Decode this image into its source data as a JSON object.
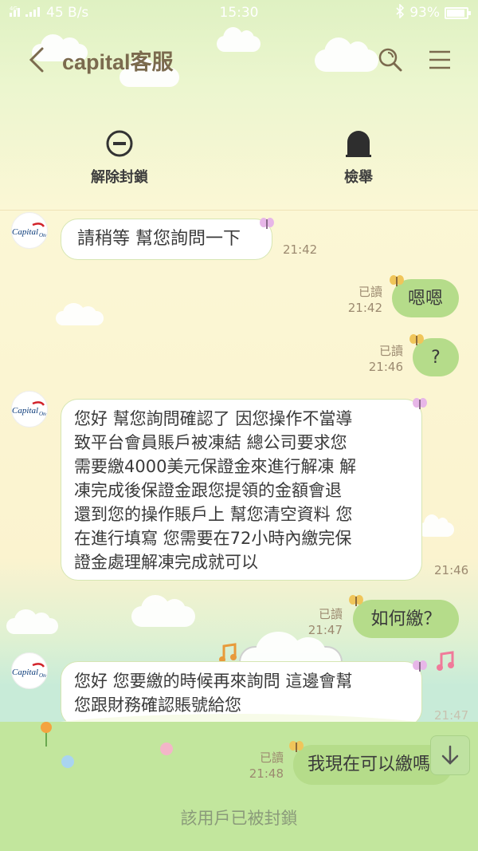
{
  "status_bar": {
    "network": "4G",
    "speed": "45 B/s",
    "time": "15:30",
    "battery": "93%",
    "battery_level": 0.93
  },
  "header": {
    "title": "capital客服",
    "back_icon": "chevron-left-icon",
    "search_icon": "search-icon",
    "menu_icon": "menu-icon"
  },
  "actions": {
    "unblock_label": "解除封鎖",
    "report_label": "檢舉"
  },
  "messages": [
    {
      "side": "in",
      "text": "請稍等 幫您詢問一下",
      "time": "21:42"
    },
    {
      "side": "out",
      "text": "嗯嗯",
      "read": "已讀",
      "time": "21:42"
    },
    {
      "side": "out",
      "text": "?",
      "read": "已讀",
      "time": "21:46"
    },
    {
      "side": "in",
      "lines": [
        "您好 幫您詢問確認了 因您操作不當導",
        "致平台會員賬戶被凍結 總公司要求您",
        "需要繳4000美元保證金來進行解凍 解",
        "凍完成後保證金跟您提領的金額會退",
        "還到您的操作賬戶上 幫您清空資料 您",
        "在進行填寫 您需要在72小時內繳完保",
        "證金處理解凍完成就可以"
      ],
      "time": "21:46"
    },
    {
      "side": "out",
      "text": "如何繳？",
      "read": "已讀",
      "time": "21:47"
    },
    {
      "side": "in",
      "lines": [
        "您好 您要繳的時候再來詢問 這邊會幫",
        "您跟財務確認賬號給您"
      ],
      "time": "21:47"
    },
    {
      "side": "out",
      "text": "我現在可以繳嗎",
      "read": "已讀",
      "time": "21:48"
    }
  ],
  "footer": {
    "blocked_text": "該用戶已被封鎖"
  },
  "avatar_text": "capital One",
  "colors": {
    "outgoing_bubble": "#b5dc8a",
    "incoming_bubble": "#ffffff",
    "title": "#7b6a4e",
    "meta": "#9c8a70"
  }
}
